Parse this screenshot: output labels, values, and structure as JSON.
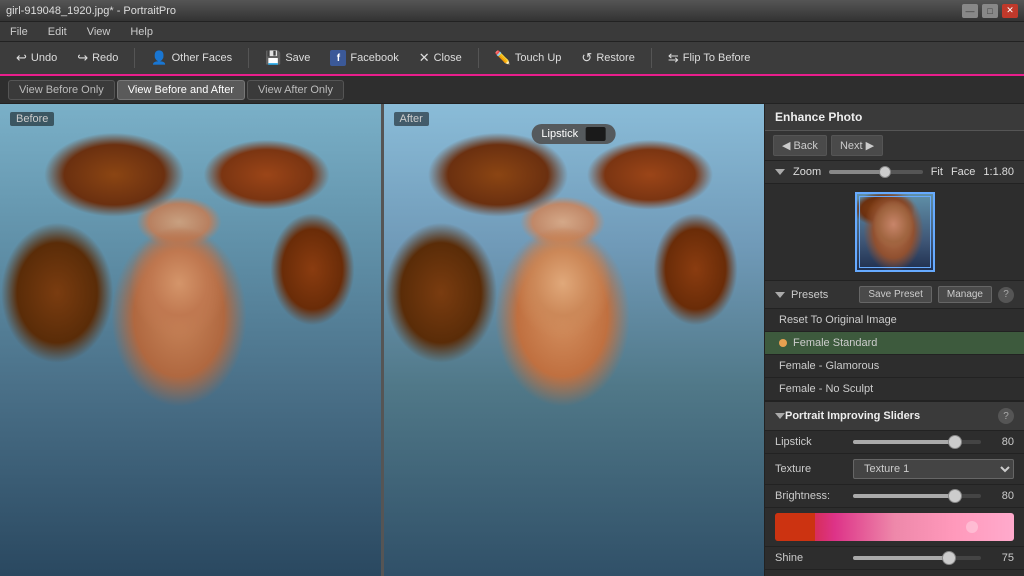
{
  "titlebar": {
    "title": "girl-919048_1920.jpg* - PortraitPro",
    "minimize_label": "—",
    "maximize_label": "□",
    "close_label": "✕"
  },
  "menubar": {
    "items": [
      "File",
      "Edit",
      "View",
      "Help"
    ]
  },
  "toolbar": {
    "undo_label": "Undo",
    "redo_label": "Redo",
    "other_faces_label": "Other Faces",
    "save_label": "Save",
    "facebook_label": "Facebook",
    "close_label": "Close",
    "touch_up_label": "Touch Up",
    "restore_label": "Restore",
    "flip_to_before_label": "Flip To Before"
  },
  "viewbar": {
    "before_only_label": "View Before Only",
    "before_and_after_label": "View Before and After",
    "after_only_label": "View After Only"
  },
  "panels": {
    "before_label": "Before",
    "after_label": "After"
  },
  "lipstick_tooltip": "Lipstick",
  "right_panel": {
    "enhance_title": "Enhance Photo",
    "back_label": "Back",
    "next_label": "Next",
    "zoom_label": "Zoom",
    "fit_label": "Fit",
    "face_label": "Face",
    "zoom_value": "1:1.80",
    "presets_label": "Presets",
    "save_preset_label": "Save Preset",
    "manage_label": "Manage",
    "preset_items": [
      {
        "label": "Reset To Original Image",
        "dot": false
      },
      {
        "label": "Female Standard",
        "dot": true
      },
      {
        "label": "Female - Glamorous",
        "dot": false
      },
      {
        "label": "Female - No Sculpt",
        "dot": false
      }
    ],
    "sliders_title": "Portrait Improving Sliders",
    "sliders": [
      {
        "label": "Lipstick",
        "value": 80,
        "percent": 80
      },
      {
        "label": "Brightness:",
        "value": 80,
        "percent": 80
      },
      {
        "label": "Shine",
        "value": 75,
        "percent": 75
      }
    ],
    "texture_label": "Texture",
    "texture_value": "Texture 1"
  }
}
